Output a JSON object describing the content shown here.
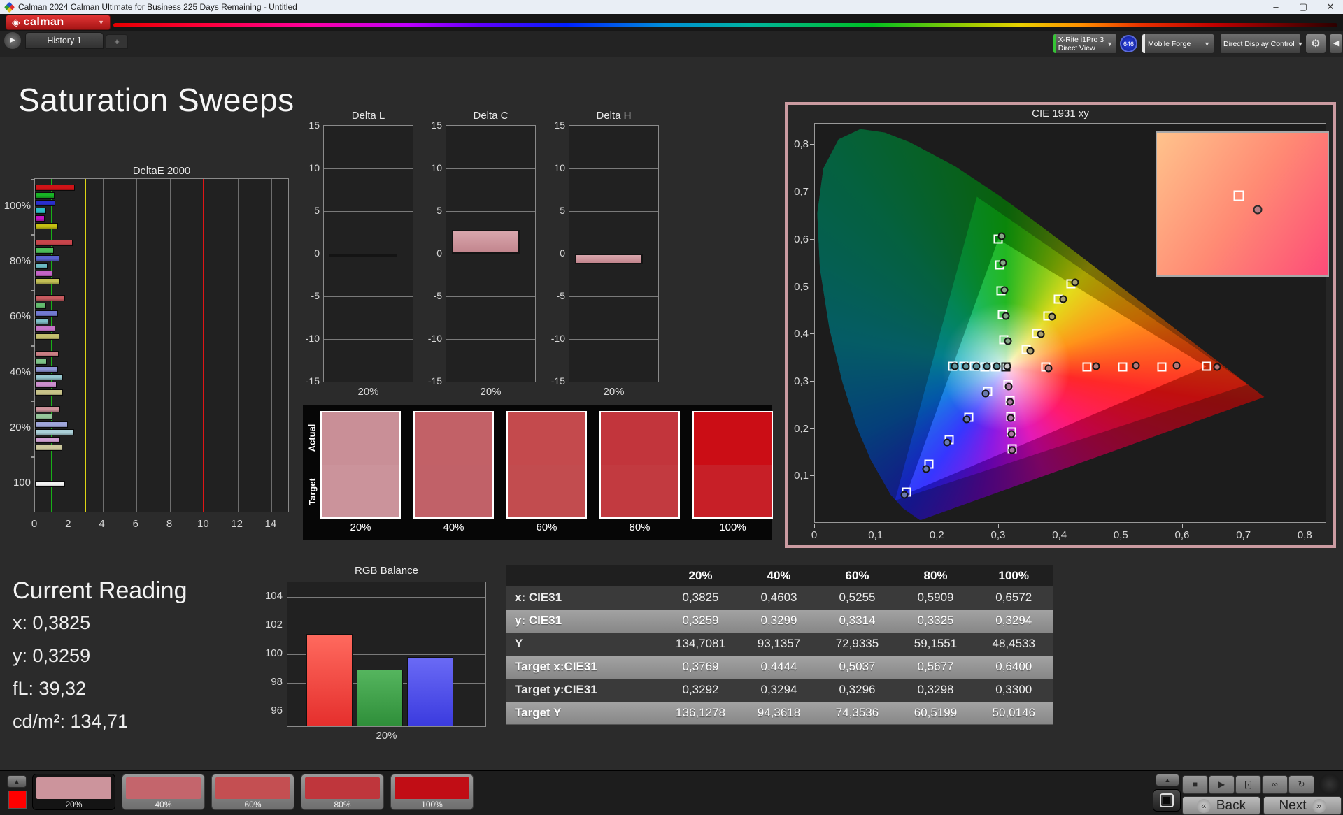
{
  "window": {
    "title": "Calman 2024 Calman Ultimate for Business 225 Days Remaining  - Untitled",
    "minimize": "–",
    "maximize": "▢",
    "close": "✕"
  },
  "brand": {
    "logo_text": "calman",
    "logo_mark": "◈",
    "caret": "▼"
  },
  "tabs": {
    "history": "History 1",
    "add": "+",
    "expander": "▶"
  },
  "toolbar": {
    "meter": {
      "line1": "X-Rite i1Pro 3",
      "line2": "Direct View",
      "accent": "#35c435"
    },
    "badge": "646",
    "source": {
      "label": "Mobile Forge",
      "accent": "#e6e6e6"
    },
    "display_control": {
      "label": "Direct Display Control",
      "accent": "#e3d50a"
    },
    "gear": "⚙",
    "collapse": "◀"
  },
  "page": {
    "title": "Saturation Sweeps"
  },
  "current_reading": {
    "title": "Current Reading",
    "lines": [
      "x: 0,3825",
      "y: 0,3259",
      "fL: 39,32",
      "cd/m²: 134,71"
    ]
  },
  "bottom_bar": {
    "up_arrow": "▲",
    "current_patch_color": "#ff0000",
    "patches": [
      {
        "label": "20%",
        "color": "#cc949c",
        "selected": true
      },
      {
        "label": "40%",
        "color": "#c4656c",
        "selected": false
      },
      {
        "label": "60%",
        "color": "#c44f52",
        "selected": false
      },
      {
        "label": "80%",
        "color": "#bf363c",
        "selected": false
      },
      {
        "label": "100%",
        "color": "#c10d15",
        "selected": false
      }
    ],
    "transport": [
      {
        "name": "stop",
        "glyph": "■"
      },
      {
        "name": "play",
        "glyph": "▶"
      },
      {
        "name": "single-measure",
        "glyph": "[·]"
      },
      {
        "name": "continuous-measure",
        "glyph": "∞"
      },
      {
        "name": "loop",
        "glyph": "↻"
      }
    ],
    "back": "Back",
    "next": "Next",
    "back_chevron": "«",
    "next_chevron": "»"
  },
  "chart_data": [
    {
      "id": "deltae2000",
      "type": "bar",
      "orientation": "horizontal",
      "title": "DeltaE 2000",
      "xlim": [
        0,
        15
      ],
      "xticks": [
        0,
        2,
        4,
        6,
        8,
        10,
        12,
        14
      ],
      "ref_lines": [
        {
          "value": 1,
          "color": "#18b018"
        },
        {
          "value": 3,
          "color": "#ddd414"
        },
        {
          "value": 10,
          "color": "#e01616"
        }
      ],
      "groups": [
        {
          "label": "100%",
          "values": [
            2.35,
            1.15,
            1.2,
            0.65,
            0.6,
            1.35
          ],
          "colors": [
            "#cf1317",
            "#17b324",
            "#2a2ecf",
            "#2cbcc6",
            "#c414c6",
            "#c6c013"
          ]
        },
        {
          "label": "80%",
          "values": [
            2.25,
            1.1,
            1.45,
            0.75,
            1.05,
            1.5
          ],
          "colors": [
            "#c8454b",
            "#4cbd59",
            "#5a62cf",
            "#6cbcc4",
            "#c463c6",
            "#c2bf55"
          ]
        },
        {
          "label": "60%",
          "values": [
            1.8,
            0.65,
            1.35,
            0.8,
            1.2,
            1.45
          ],
          "colors": [
            "#c85b60",
            "#63bb6e",
            "#7179d1",
            "#7fc0c8",
            "#c676c8",
            "#c4bf6e"
          ]
        },
        {
          "label": "40%",
          "values": [
            1.4,
            0.7,
            1.35,
            1.65,
            1.3,
            1.65
          ],
          "colors": [
            "#cb7f85",
            "#7fc489",
            "#8e95d6",
            "#97c8cf",
            "#cc8ecd",
            "#c8c389"
          ]
        },
        {
          "label": "20%",
          "values": [
            1.5,
            1.05,
            1.95,
            2.3,
            1.5,
            1.6
          ],
          "colors": [
            "#cd939b",
            "#95c69a",
            "#9fa6da",
            "#abd0d8",
            "#d0a0d1",
            "#ccc89c"
          ]
        },
        {
          "label": "100",
          "values": [
            1.8
          ],
          "colors": [
            "#f2f2f2"
          ]
        }
      ]
    },
    {
      "id": "delta_l",
      "type": "bar",
      "title": "Delta L",
      "categories": [
        "20%"
      ],
      "values": [
        -0.25
      ],
      "ylim": [
        -15,
        15
      ],
      "yticks": [
        15,
        10,
        5,
        0,
        -5,
        -10,
        -15
      ],
      "bar_color_top": "#d9a6ad",
      "bar_color_bottom": "#c2858d"
    },
    {
      "id": "delta_c",
      "type": "bar",
      "title": "Delta C",
      "categories": [
        "20%"
      ],
      "values": [
        2.8
      ],
      "ylim": [
        -15,
        15
      ],
      "yticks": [
        15,
        10,
        5,
        0,
        -5,
        -10,
        -15
      ],
      "bar_color_top": "#d9a6ad",
      "bar_color_bottom": "#c2858d"
    },
    {
      "id": "delta_h",
      "type": "bar",
      "title": "Delta H",
      "categories": [
        "20%"
      ],
      "values": [
        -1.2
      ],
      "ylim": [
        -15,
        15
      ],
      "yticks": [
        15,
        10,
        5,
        0,
        -5,
        -10,
        -15
      ],
      "bar_color_top": "#d9a6ad",
      "bar_color_bottom": "#c2858d"
    },
    {
      "id": "saturation_swatches",
      "type": "swatches",
      "row_labels": [
        "Actual",
        "Target"
      ],
      "categories": [
        "20%",
        "40%",
        "60%",
        "80%",
        "100%"
      ],
      "actual_colors": [
        "#c98f97",
        "#c26167",
        "#c44a4d",
        "#c2353c",
        "#cb0d15"
      ],
      "target_colors": [
        "#cb939b",
        "#c16168",
        "#c24c4f",
        "#c23a40",
        "#c71f27"
      ]
    },
    {
      "id": "cie1931",
      "type": "scatter",
      "title": "CIE 1931 xy",
      "xlim": [
        0,
        0.835
      ],
      "ylim": [
        0,
        0.845
      ],
      "xtick_values": [
        0,
        0.1,
        0.2,
        0.3,
        0.4,
        0.5,
        0.6,
        0.7,
        0.8
      ],
      "xtick_labels": [
        "0",
        "0,1",
        "0,2",
        "0,3",
        "0,4",
        "0,5",
        "0,6",
        "0,7",
        "0,8"
      ],
      "ytick_values": [
        0,
        0.1,
        0.2,
        0.3,
        0.4,
        0.5,
        0.6,
        0.7,
        0.8
      ],
      "ytick_labels": [
        "0",
        "0,1",
        "0,2",
        "0,3",
        "0,4",
        "0,5",
        "0,6",
        "0,7",
        "0,8"
      ],
      "locus": [
        [
          0.1741,
          0.005
        ],
        [
          0.1714,
          0.0051
        ],
        [
          0.1644,
          0.0109
        ],
        [
          0.144,
          0.0297
        ],
        [
          0.1241,
          0.0578
        ],
        [
          0.0913,
          0.1327
        ],
        [
          0.0687,
          0.2007
        ],
        [
          0.0454,
          0.295
        ],
        [
          0.0235,
          0.4127
        ],
        [
          0.0082,
          0.5384
        ],
        [
          0.0039,
          0.6548
        ],
        [
          0.0139,
          0.7502
        ],
        [
          0.0389,
          0.812
        ],
        [
          0.0743,
          0.8338
        ],
        [
          0.1142,
          0.8262
        ],
        [
          0.1547,
          0.8059
        ],
        [
          0.2296,
          0.7543
        ],
        [
          0.3016,
          0.6923
        ],
        [
          0.3731,
          0.6245
        ],
        [
          0.4441,
          0.5547
        ],
        [
          0.5125,
          0.4866
        ],
        [
          0.5752,
          0.4242
        ],
        [
          0.627,
          0.3725
        ],
        [
          0.6658,
          0.334
        ],
        [
          0.6915,
          0.3083
        ],
        [
          0.714,
          0.2859
        ],
        [
          0.7347,
          0.2653
        ]
      ],
      "gamut_triangles": {
        "outer": [
          [
            0.708,
            0.292
          ],
          [
            0.265,
            0.69
          ],
          [
            0.131,
            0.046
          ]
        ],
        "rec709": [
          [
            0.64,
            0.33
          ],
          [
            0.3,
            0.6
          ],
          [
            0.15,
            0.06
          ]
        ]
      },
      "white_point": {
        "target": [
          0.3127,
          0.329
        ],
        "measured": [
          0.314,
          0.33
        ],
        "measured_color": "#cccccc"
      },
      "sweeps": [
        {
          "name": "red",
          "measured_color": "#b47878",
          "targets": [
            [
              0.3769,
              0.3292
            ],
            [
              0.4444,
              0.3294
            ],
            [
              0.5037,
              0.3296
            ],
            [
              0.5677,
              0.3298
            ],
            [
              0.64,
              0.33
            ]
          ],
          "measured": [
            [
              0.3825,
              0.3259
            ],
            [
              0.4603,
              0.3299
            ],
            [
              0.5255,
              0.3314
            ],
            [
              0.5909,
              0.3325
            ],
            [
              0.6572,
              0.3294
            ]
          ]
        },
        {
          "name": "green",
          "measured_color": "#86a886",
          "targets": [
            [
              0.309,
              0.3862
            ],
            [
              0.3062,
              0.4397
            ],
            [
              0.304,
              0.491
            ],
            [
              0.3018,
              0.546
            ],
            [
              0.3,
              0.6
            ]
          ],
          "measured": [
            [
              0.3155,
              0.3835
            ],
            [
              0.312,
              0.438
            ],
            [
              0.3098,
              0.4925
            ],
            [
              0.3075,
              0.5505
            ],
            [
              0.3058,
              0.606
            ]
          ]
        },
        {
          "name": "yellow",
          "measured_color": "#a8a070",
          "targets": [
            [
              0.345,
              0.3655
            ],
            [
              0.3625,
              0.401
            ],
            [
              0.381,
              0.437
            ],
            [
              0.398,
              0.473
            ],
            [
              0.419,
              0.506
            ]
          ],
          "measured": [
            [
              0.352,
              0.3635
            ],
            [
              0.37,
              0.399
            ],
            [
              0.388,
              0.436
            ],
            [
              0.406,
              0.473
            ],
            [
              0.426,
              0.508
            ]
          ]
        },
        {
          "name": "cyan",
          "measured_color": "#6098a0",
          "targets": [
            [
              0.2953,
              0.3293
            ],
            [
              0.2779,
              0.3296
            ],
            [
              0.2606,
              0.3299
            ],
            [
              0.2432,
              0.3302
            ],
            [
              0.2258,
              0.3305
            ]
          ],
          "measured": [
            [
              0.2975,
              0.33
            ],
            [
              0.281,
              0.33
            ],
            [
              0.264,
              0.3305
            ],
            [
              0.247,
              0.33
            ],
            [
              0.229,
              0.33
            ]
          ]
        },
        {
          "name": "magenta",
          "measured_color": "#a878a0",
          "targets": [
            [
              0.316,
              0.292
            ],
            [
              0.319,
              0.258
            ],
            [
              0.32,
              0.224
            ],
            [
              0.321,
              0.1905
            ],
            [
              0.322,
              0.155
            ]
          ],
          "measured": [
            [
              0.3165,
              0.288
            ],
            [
              0.3195,
              0.2545
            ],
            [
              0.3205,
              0.221
            ],
            [
              0.3215,
              0.1875
            ],
            [
              0.3225,
              0.153
            ]
          ]
        },
        {
          "name": "blue",
          "measured_color": "#6878b0",
          "targets": [
            [
              0.283,
              0.277
            ],
            [
              0.252,
              0.222
            ],
            [
              0.22,
              0.175
            ],
            [
              0.187,
              0.123
            ],
            [
              0.15,
              0.064
            ]
          ],
          "measured": [
            [
              0.279,
              0.273
            ],
            [
              0.248,
              0.218
            ],
            [
              0.216,
              0.169
            ],
            [
              0.182,
              0.112
            ],
            [
              0.146,
              0.058
            ]
          ]
        }
      ],
      "inset": {
        "square": [
          0.48,
          0.44
        ],
        "circle": [
          0.59,
          0.54
        ],
        "circle_color": "#b97f86"
      }
    },
    {
      "id": "rgb_balance",
      "type": "bar",
      "title": "RGB Balance",
      "categories": [
        "20%"
      ],
      "series": [
        {
          "name": "Red",
          "value": 101.4,
          "color_top": "#ff6a5e",
          "color_bottom": "#e52f2d"
        },
        {
          "name": "Green",
          "value": 98.95,
          "color_top": "#55b55e",
          "color_bottom": "#2f8f3a"
        },
        {
          "name": "Blue",
          "value": 99.8,
          "color_top": "#6a6af5",
          "color_bottom": "#3b3bdf"
        }
      ],
      "ylim": [
        95,
        105
      ],
      "yticks": [
        104,
        102,
        100,
        98,
        96
      ]
    },
    {
      "id": "measurement_table",
      "type": "table",
      "columns": [
        "",
        "20%",
        "40%",
        "60%",
        "80%",
        "100%"
      ],
      "rows": [
        {
          "label": "x: CIE31",
          "values": [
            "0,3825",
            "0,4603",
            "0,5255",
            "0,5909",
            "0,6572"
          ]
        },
        {
          "label": "y: CIE31",
          "values": [
            "0,3259",
            "0,3299",
            "0,3314",
            "0,3325",
            "0,3294"
          ]
        },
        {
          "label": "Y",
          "values": [
            "134,7081",
            "93,1357",
            "72,9335",
            "59,1551",
            "48,4533"
          ]
        },
        {
          "label": "Target x:CIE31",
          "values": [
            "0,3769",
            "0,4444",
            "0,5037",
            "0,5677",
            "0,6400"
          ]
        },
        {
          "label": "Target y:CIE31",
          "values": [
            "0,3292",
            "0,3294",
            "0,3296",
            "0,3298",
            "0,3300"
          ]
        },
        {
          "label": "Target Y",
          "values": [
            "136,1278",
            "94,3618",
            "74,3536",
            "60,5199",
            "50,0146"
          ]
        }
      ]
    }
  ]
}
